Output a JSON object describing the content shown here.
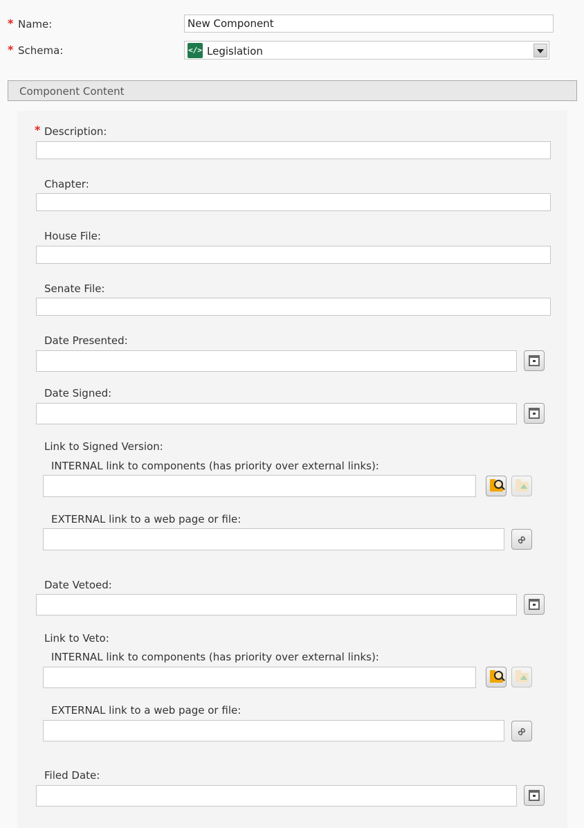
{
  "header": {
    "name_label": "Name:",
    "name_value": "New Component",
    "schema_label": "Schema:",
    "schema_value": "Legislation",
    "schema_icon": "</>",
    "required_marker": "*"
  },
  "section": {
    "title": "Component Content"
  },
  "fields": {
    "description": "Description:",
    "chapter": "Chapter:",
    "house_file": "House File:",
    "senate_file": "Senate File:",
    "date_presented": "Date Presented:",
    "date_signed": "Date Signed:",
    "link_signed": "Link to Signed Version:",
    "internal_link": "INTERNAL link to components (has priority over external links):",
    "external_link": "EXTERNAL link to a web page or file:",
    "date_vetoed": "Date Vetoed:",
    "link_veto": "Link to Veto:",
    "filed_date": "Filed Date:"
  },
  "icons": {
    "calendar": "calendar-icon",
    "browse": "browse-folder-icon",
    "upload": "upload-folder-icon",
    "hyperlink": "hyperlink-icon",
    "dropdown": "chevron-down-icon",
    "schema": "schema-icon"
  },
  "colors": {
    "required": "#e3211b",
    "schema_icon_bg": "#1e7a4c",
    "folder": "#f0a500"
  }
}
